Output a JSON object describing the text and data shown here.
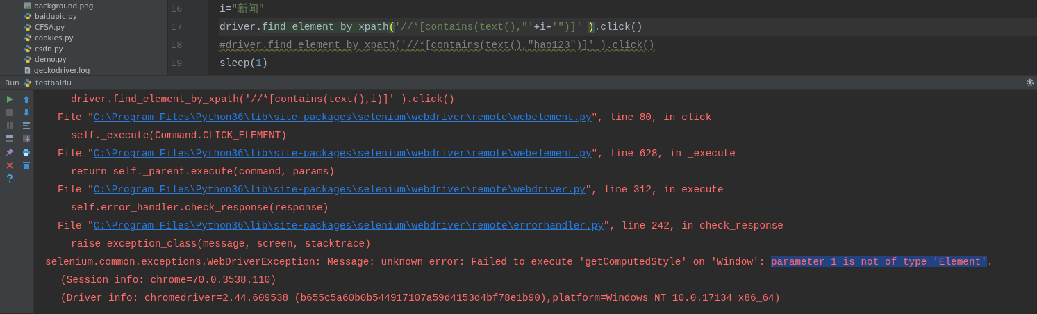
{
  "project_tree": {
    "items": [
      {
        "name": "background.png",
        "kind": "image"
      },
      {
        "name": "baidupic.py",
        "kind": "python"
      },
      {
        "name": "CFSA.py",
        "kind": "python"
      },
      {
        "name": "cookies.py",
        "kind": "python"
      },
      {
        "name": "csdn.py",
        "kind": "python"
      },
      {
        "name": "demo.py",
        "kind": "python"
      },
      {
        "name": "geckodriver.log",
        "kind": "log"
      }
    ]
  },
  "editor": {
    "lines": [
      {
        "number": "16",
        "tokens": [
          {
            "text": "i",
            "kind": "plain"
          },
          {
            "text": "=",
            "kind": "plain"
          },
          {
            "text": "\"新闻\"",
            "kind": "string"
          }
        ]
      },
      {
        "number": "17",
        "current": true,
        "tokens": [
          {
            "text": "driver.",
            "kind": "plain"
          },
          {
            "text": "find_element_by_xpath",
            "kind": "highlight"
          },
          {
            "text": "(",
            "kind": "match"
          },
          {
            "text": "'//*[contains(text(),\"'",
            "kind": "string"
          },
          {
            "text": "+i+",
            "kind": "plain"
          },
          {
            "text": "'\")]' ",
            "kind": "string"
          },
          {
            "text": ")",
            "kind": "match"
          },
          {
            "text": ".click()",
            "kind": "plain"
          }
        ]
      },
      {
        "number": "18",
        "tokens": [
          {
            "text": "#driver.find_element_by_xpath('//*[contains(text(),\"hao123\")]' ).click()",
            "kind": "comment"
          }
        ]
      },
      {
        "number": "19",
        "tokens": [
          {
            "text": "sleep(",
            "kind": "plain"
          },
          {
            "text": "1",
            "kind": "number"
          },
          {
            "text": ")",
            "kind": "plain"
          }
        ]
      }
    ]
  },
  "run_panel": {
    "label": "Run",
    "config": "testbaidu"
  },
  "console": {
    "lines": [
      {
        "kind": "code",
        "text": "driver.find_element_by_xpath('//*[contains(text(),i)]' ).click()"
      },
      {
        "kind": "file",
        "prefix": "File \"",
        "link": "C:\\Program Files\\Python36\\lib\\site-packages\\selenium\\webdriver\\remote\\webelement.py",
        "suffix": "\", line 80, in click"
      },
      {
        "kind": "code",
        "text": "self._execute(Command.CLICK_ELEMENT)"
      },
      {
        "kind": "file",
        "prefix": "File \"",
        "link": "C:\\Program Files\\Python36\\lib\\site-packages\\selenium\\webdriver\\remote\\webelement.py",
        "suffix": "\", line 628, in _execute"
      },
      {
        "kind": "code",
        "text": "return self._parent.execute(command, params)"
      },
      {
        "kind": "file",
        "prefix": "File \"",
        "link": "C:\\Program Files\\Python36\\lib\\site-packages\\selenium\\webdriver\\remote\\webdriver.py",
        "suffix": "\", line 312, in execute"
      },
      {
        "kind": "code",
        "text": "self.error_handler.check_response(response)"
      },
      {
        "kind": "file",
        "prefix": "File \"",
        "link": "C:\\Program Files\\Python36\\lib\\site-packages\\selenium\\webdriver\\remote\\errorhandler.py",
        "suffix": "\", line 242, in check_response"
      },
      {
        "kind": "code",
        "text": "raise exception_class(message, screen, stacktrace)"
      },
      {
        "kind": "error",
        "text": "selenium.common.exceptions.WebDriverException: Message: unknown error: Failed to execute 'getComputedStyle' on 'Window': ",
        "selected_text": "parameter 1 is not of type 'Element'",
        "suffix": "."
      },
      {
        "kind": "info",
        "text": "(Session info: chrome=70.0.3538.110)"
      },
      {
        "kind": "info",
        "text": "(Driver info: chromedriver=2.44.609538 (b655c5a60b0b544917107a59d4153d4bf78e1b90),platform=Windows NT 10.0.17134 x86_64)"
      }
    ]
  }
}
